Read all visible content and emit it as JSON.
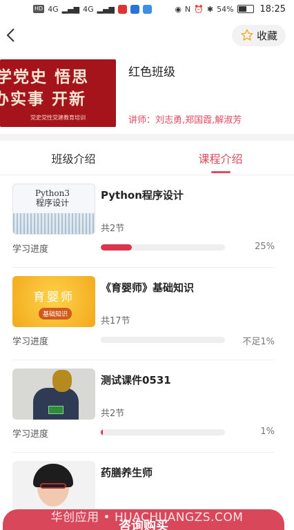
{
  "status_bar": {
    "left_badges": [
      "HD",
      "4G",
      "4G"
    ],
    "battery": "54%",
    "time": "18:25"
  },
  "nav": {
    "back_icon": "chevron-left-icon",
    "favorite_label": "收藏",
    "favorite_icon": "star-outline-icon"
  },
  "class": {
    "cover_line1": "学党史 悟思",
    "cover_line2": "办实事 开新",
    "cover_caption": "党史党性党建教育培训",
    "title": "红色班级",
    "teachers": "讲师：刘志勇,郑国霞,解淑芳"
  },
  "tabs": [
    {
      "label": "班级介绍",
      "active": false
    },
    {
      "label": "课程介绍",
      "active": true
    }
  ],
  "progress_label": "学习进度",
  "courses": [
    {
      "title": "Python程序设计",
      "sessions": "共2节",
      "progress": 0.25,
      "progress_text": "25%",
      "thumb_text_1": "Python3",
      "thumb_text_2": "程序设计"
    },
    {
      "title": "《育婴师》基础知识",
      "sessions": "共17节",
      "progress": 0.0,
      "progress_text": "不足1%",
      "thumb_text_1": "育婴师",
      "thumb_text_2": "基础知识"
    },
    {
      "title": "测试课件0531",
      "sessions": "共2节",
      "progress": 0.01,
      "progress_text": "1%"
    },
    {
      "title": "药膳养生师"
    }
  ],
  "bottom": {
    "buy_label": "咨询购买",
    "watermark": "华创应用 • HUACHUANGZS.COM"
  },
  "colors": {
    "accent": "#e04a5e",
    "progress_fill": "#d9364d",
    "button": "#d9475a"
  }
}
